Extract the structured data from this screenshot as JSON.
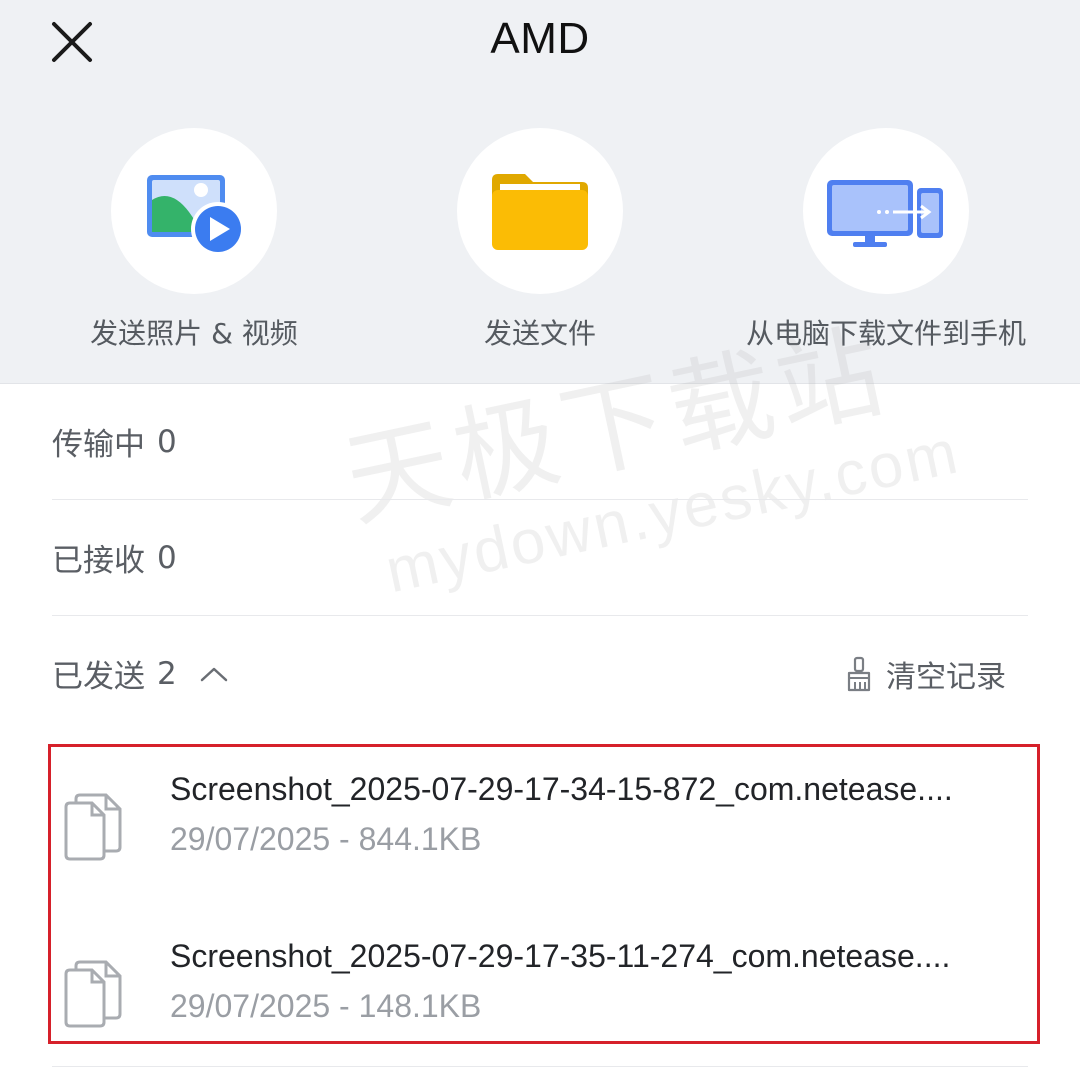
{
  "header": {
    "title": "AMD",
    "close_icon": "close-icon"
  },
  "actions": [
    {
      "label": "发送照片 & 视频",
      "icon": "photo-video-icon"
    },
    {
      "label": "发送文件",
      "icon": "folder-icon"
    },
    {
      "label": "从电脑下载文件到手机",
      "icon": "computer-to-phone-icon"
    }
  ],
  "sections": {
    "transferring": {
      "label": "传输中",
      "count": "0"
    },
    "received": {
      "label": "已接收",
      "count": "0"
    },
    "sent": {
      "label": "已发送",
      "count": "2",
      "toggle_icon": "chevron-up-icon",
      "clear_label": "清空记录",
      "clear_icon": "broom-icon"
    }
  },
  "sent_files": [
    {
      "name": "Screenshot_2025-07-29-17-34-15-872_com.netease....",
      "date": "29/07/2025",
      "size": "844.1KB",
      "meta": "29/07/2025 - 844.1KB"
    },
    {
      "name": "Screenshot_2025-07-29-17-35-11-274_com.netease....",
      "date": "29/07/2025",
      "size": "148.1KB",
      "meta": "29/07/2025 - 148.1KB"
    }
  ],
  "watermark": {
    "cn": "天极下载站",
    "en": "mydown.yesky.com"
  },
  "colors": {
    "header_bg": "#eff1f4",
    "highlight_border": "#d6202a",
    "folder_yellow": "#fbbc05",
    "accent_blue": "#3b82f6"
  }
}
